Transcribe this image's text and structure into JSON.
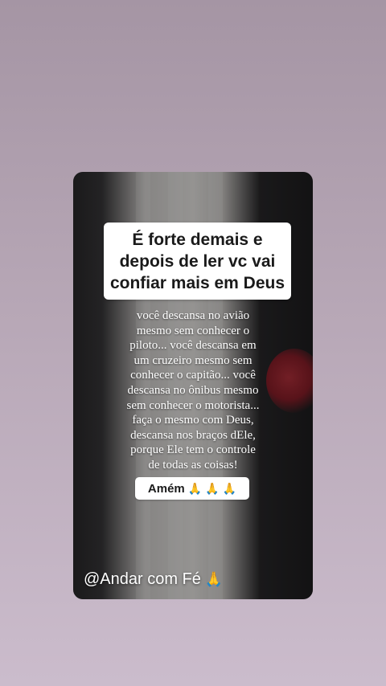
{
  "post": {
    "title": "É forte demais e\ndepois de ler vc vai\nconfiar mais em Deus",
    "body": "você descansa no avião\nmesmo sem conhecer o\npiloto... você descansa em\num cruzeiro mesmo sem\nconhecer o capitão... você\ndescansa no ônibus mesmo\nsem conhecer o motorista...\nfaça o mesmo com Deus,\ndescansa nos braços dEle,\nporque Ele tem o controle\nde todas as coisas!",
    "amen_label": "Amém",
    "amen_emojis": [
      "🙏",
      "🙏",
      "🙏"
    ],
    "handle_label": "@Andar com Fé",
    "handle_emoji": "🙏"
  },
  "icons": {
    "amen": "praying-hands-icon",
    "handle": "praying-hands-icon"
  },
  "colors": {
    "background_top": "#a595a4",
    "background_bottom": "#cbbccc",
    "text_on_image": "#ffffff",
    "label_box": "#ffffff",
    "flower": "#b8323d"
  }
}
